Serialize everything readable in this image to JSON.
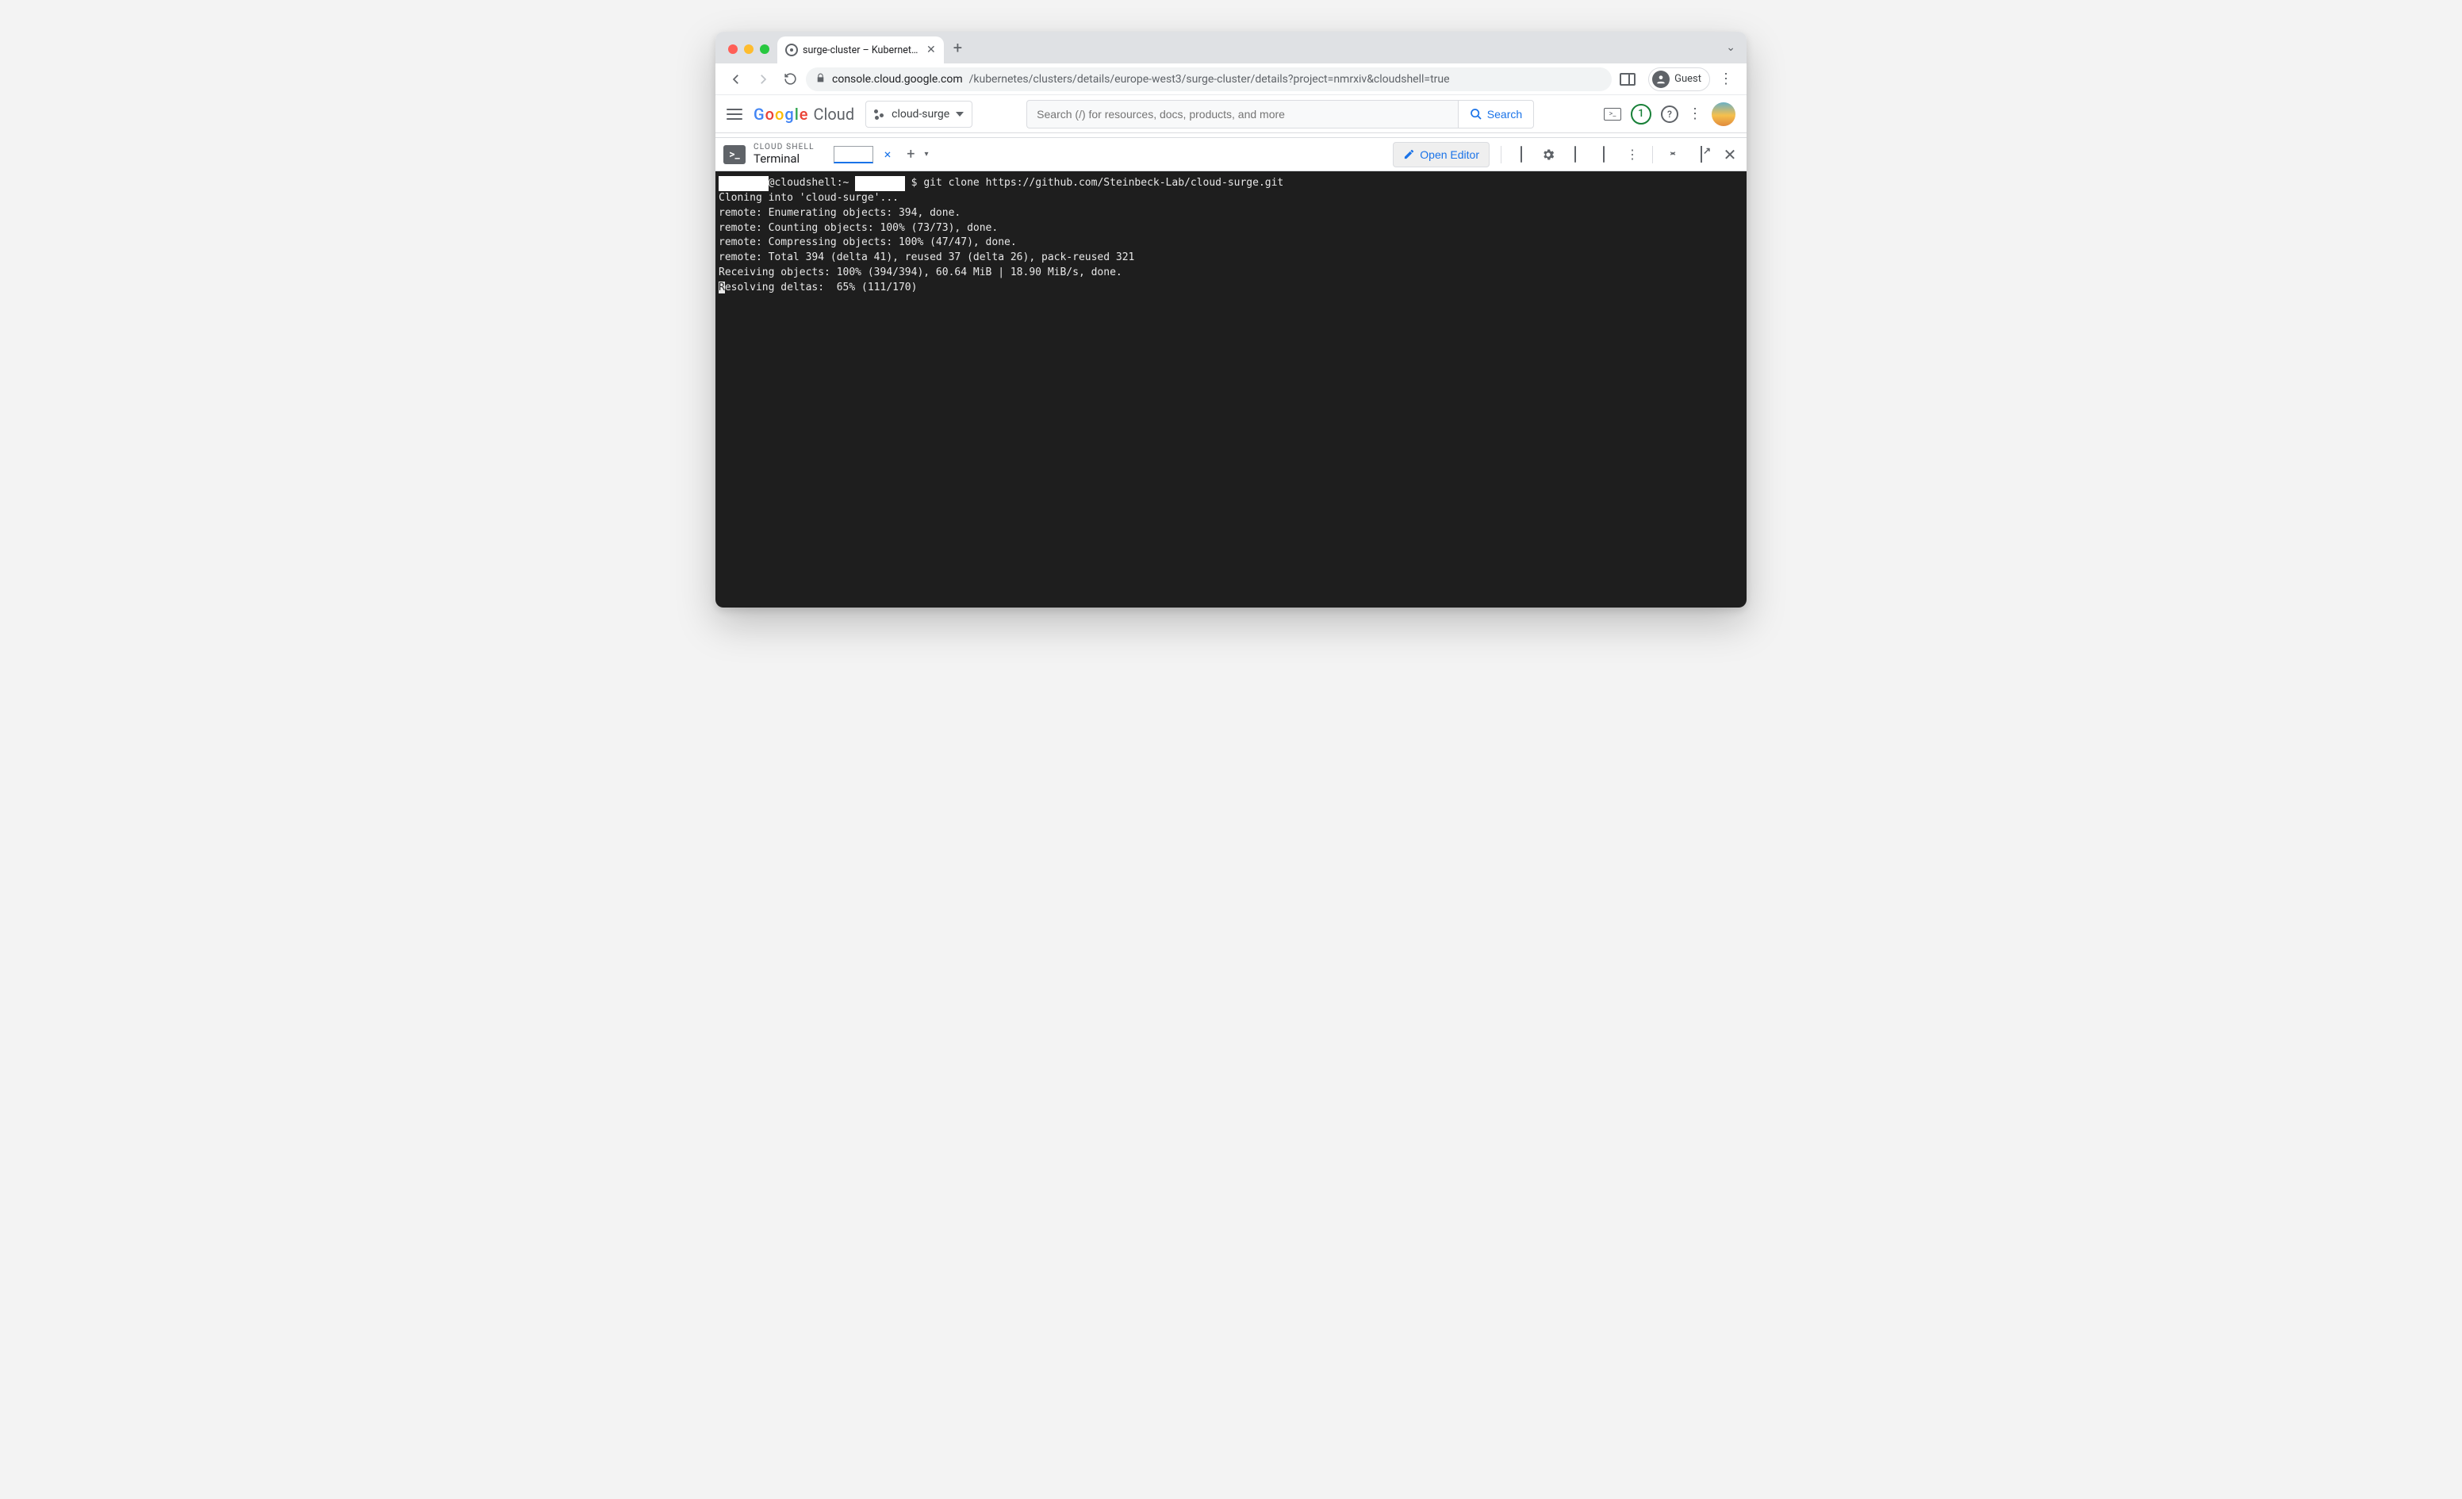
{
  "browser": {
    "tab_title": "surge-cluster – Kubernetes E…",
    "url_host": "console.cloud.google.com",
    "url_path": "/kubernetes/clusters/details/europe-west3/surge-cluster/details?project=nmrxiv&cloudshell=true",
    "guest_label": "Guest"
  },
  "header": {
    "logo_cloud": "Cloud",
    "project_name": "cloud-surge",
    "search_placeholder": "Search (/) for resources, docs, products, and more",
    "search_button": "Search",
    "badge_count": "1"
  },
  "cloudshell": {
    "subtitle": "CLOUD SHELL",
    "title": "Terminal",
    "open_editor": "Open Editor"
  },
  "terminal": {
    "prompt_prefix": "        ",
    "prompt_mid": "@cloudshell:~ ",
    "prompt_redact2": "        ",
    "prompt_dollar": "$ ",
    "command": "git clone https://github.com/Steinbeck-Lab/cloud-surge.git",
    "lines": [
      "Cloning into 'cloud-surge'...",
      "remote: Enumerating objects: 394, done.",
      "remote: Counting objects: 100% (73/73), done.",
      "remote: Compressing objects: 100% (47/47), done.",
      "remote: Total 394 (delta 41), reused 37 (delta 26), pack-reused 321",
      "Receiving objects: 100% (394/394), 60.64 MiB | 18.90 MiB/s, done."
    ],
    "last_line_cursor": "R",
    "last_line_rest": "esolving deltas:  65% (111/170)"
  }
}
